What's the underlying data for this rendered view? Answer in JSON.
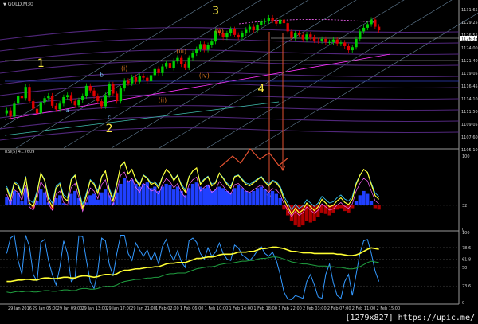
{
  "title": "GOLD,M30",
  "indicator_label": "RSI(5) 41.7609",
  "footer": "[1279x827] https://upic.me/",
  "colors": {
    "background": "#000000",
    "bull": "#00d100",
    "bear": "#e00000",
    "rsi": "#ffff33",
    "osc": "#3399ff",
    "hist_pos": "#2040ff",
    "hist_neg": "#b00000",
    "wave": "#ffee44",
    "sub": "#d07020",
    "arrow": "#e05030",
    "channel": "#5a2b8a",
    "trend": "#ff33ff"
  },
  "chart_data": {
    "type": "candlestick",
    "price_axis": [
      "1131.65",
      "1129.25",
      "1126.55",
      "1124.00",
      "1121.40",
      "1119.05",
      "1116.45",
      "1114.10",
      "1111.50",
      "1109.05",
      "1107.60",
      "1105.10"
    ],
    "price_range": [
      1104.8,
      1132.6
    ],
    "last_price": "1126.35",
    "close_series": [
      1112.2,
      1111.0,
      1113.5,
      1115.0,
      1114.6,
      1116.8,
      1114.0,
      1112.5,
      1111.6,
      1113.8,
      1114.6,
      1115.1,
      1113.1,
      1112.4,
      1113.5,
      1114.8,
      1115.2,
      1114.0,
      1113.2,
      1114.2,
      1115.0,
      1117.0,
      1116.1,
      1115.0,
      1114.0,
      1113.0,
      1115.2,
      1117.3,
      1115.5,
      1114.0,
      1116.5,
      1118.0,
      1117.5,
      1118.7,
      1117.8,
      1118.9,
      1118.6,
      1117.9,
      1119.1,
      1120.3,
      1119.5,
      1120.8,
      1121.5,
      1120.5,
      1121.9,
      1122.5,
      1121.2,
      1120.6,
      1122.5,
      1123.4,
      1124.2,
      1125.2,
      1124.1,
      1125.0,
      1125.7,
      1127.8,
      1127.4,
      1126.5,
      1127.3,
      1128.1,
      1127.0,
      1126.5,
      1127.3,
      1128.0,
      1128.6,
      1127.9,
      1128.9,
      1129.6,
      1129.7,
      1130.4,
      1129.8,
      1129.2,
      1130.0,
      1129.3,
      1127.7,
      1126.4,
      1127.3,
      1127.0,
      1126.1,
      1127.1,
      1126.5,
      1125.9,
      1125.8,
      1126.2,
      1125.6,
      1125.6,
      1126.1,
      1125.3,
      1125.5,
      1124.8,
      1124.0,
      1124.6,
      1126.2,
      1127.7,
      1128.4,
      1129.1,
      1130.0,
      1128.6,
      1127.9
    ],
    "wave_labels": [
      {
        "text": "1",
        "price": 1120.7,
        "bar": 9,
        "style": "major"
      },
      {
        "text": "2",
        "price": 1107.9,
        "bar": 27,
        "style": "major"
      },
      {
        "text": "3",
        "price": 1131.0,
        "bar": 55,
        "style": "major"
      },
      {
        "text": "4",
        "price": 1115.7,
        "bar": 67,
        "style": "major"
      },
      {
        "text": "a",
        "price": 1111.8,
        "bar": 16,
        "style": "minor"
      },
      {
        "text": "b",
        "price": 1118.8,
        "bar": 25,
        "style": "minor"
      },
      {
        "text": "c",
        "price": 1110.5,
        "bar": 27,
        "style": "minor"
      },
      {
        "text": "(i)",
        "price": 1120.0,
        "bar": 31,
        "style": "sub"
      },
      {
        "text": "(ii)",
        "price": 1113.8,
        "bar": 41,
        "style": "sub"
      },
      {
        "text": "(iii)",
        "price": 1123.4,
        "bar": 46,
        "style": "sub"
      },
      {
        "text": "(iv)",
        "price": 1118.6,
        "bar": 52,
        "style": "sub"
      },
      {
        "text": "(v)",
        "price": 1127.4,
        "bar": 56,
        "style": "sub"
      }
    ],
    "time_labels": [
      "29 Jan 2016",
      "29 Jan 05:00",
      "29 Jan 09:00",
      "29 Jan 13:00",
      "29 Jan 17:00",
      "29 Jan 21:00",
      "1 Feb 02:00",
      "1 Feb 06:00",
      "1 Feb 10:00",
      "1 Feb 14:00",
      "1 Feb 18:00",
      "1 Feb 22:00",
      "2 Feb 03:00",
      "2 Feb 07:00",
      "2 Feb 11:00",
      "2 Feb 15:00"
    ],
    "rsi": {
      "axis": [
        "100",
        "32",
        "0"
      ],
      "values": [
        55,
        40,
        62,
        58,
        45,
        70,
        35,
        30,
        48,
        75,
        65,
        40,
        30,
        55,
        60,
        42,
        38,
        66,
        72,
        50,
        28,
        45,
        65,
        60,
        48,
        70,
        78,
        52,
        38,
        60,
        85,
        90,
        74,
        80,
        66,
        58,
        72,
        68,
        60,
        62,
        55,
        70,
        80,
        75,
        65,
        72,
        58,
        50,
        70,
        78,
        82,
        60,
        66,
        70,
        58,
        62,
        75,
        68,
        60,
        55,
        70,
        72,
        66,
        60,
        58,
        62,
        66,
        70,
        63,
        58,
        64,
        62,
        55,
        40,
        30,
        20,
        28,
        22,
        26,
        35,
        30,
        25,
        30,
        40,
        35,
        30,
        32,
        38,
        42,
        36,
        33,
        40,
        60,
        72,
        80,
        76,
        60,
        45,
        40
      ],
      "histogram": [
        12,
        8,
        20,
        18,
        6,
        24,
        2,
        -4,
        6,
        22,
        18,
        4,
        -6,
        10,
        14,
        3,
        0,
        16,
        20,
        10,
        -4,
        4,
        14,
        16,
        8,
        18,
        22,
        14,
        4,
        18,
        30,
        38,
        34,
        36,
        30,
        26,
        30,
        32,
        24,
        26,
        20,
        26,
        30,
        28,
        22,
        26,
        20,
        14,
        24,
        30,
        32,
        26,
        24,
        28,
        20,
        22,
        26,
        24,
        20,
        18,
        24,
        28,
        24,
        20,
        18,
        20,
        24,
        26,
        22,
        18,
        20,
        16,
        10,
        -6,
        -14,
        -22,
        -28,
        -30,
        -28,
        -22,
        -24,
        -22,
        -16,
        -10,
        -12,
        -14,
        -10,
        -6,
        -4,
        -8,
        -10,
        -4,
        6,
        14,
        20,
        16,
        6,
        -4,
        -6
      ]
    },
    "oscillator": {
      "axis": [
        "100",
        "78.6",
        "61.8",
        "50",
        "23.6",
        "0"
      ],
      "blue": [
        70,
        92,
        96,
        60,
        40,
        96,
        80,
        40,
        30,
        86,
        90,
        60,
        40,
        25,
        50,
        88,
        70,
        30,
        35,
        95,
        94,
        60,
        30,
        20,
        45,
        92,
        88,
        55,
        38,
        70,
        96,
        96,
        70,
        60,
        85,
        75,
        66,
        75,
        60,
        72,
        55,
        80,
        90,
        70,
        60,
        74,
        58,
        50,
        88,
        92,
        86,
        70,
        62,
        78,
        66,
        72,
        85,
        70,
        62,
        60,
        82,
        78,
        68,
        64,
        60,
        66,
        74,
        80,
        70,
        66,
        72,
        60,
        40,
        15,
        5,
        4,
        10,
        8,
        6,
        30,
        40,
        25,
        8,
        6,
        40,
        55,
        28,
        10,
        6,
        30,
        40,
        10,
        40,
        70,
        88,
        90,
        70,
        45,
        30
      ],
      "yellow": [
        30,
        30,
        31,
        32,
        32,
        33,
        33,
        32,
        32,
        34,
        35,
        35,
        34,
        34,
        35,
        36,
        36,
        35,
        35,
        37,
        38,
        38,
        37,
        36,
        37,
        39,
        40,
        40,
        39,
        41,
        44,
        46,
        46,
        47,
        48,
        48,
        49,
        50,
        50,
        51,
        51,
        53,
        55,
        56,
        56,
        57,
        57,
        57,
        59,
        61,
        63,
        63,
        64,
        65,
        65,
        66,
        68,
        69,
        69,
        69,
        70,
        72,
        72,
        72,
        73,
        73,
        75,
        77,
        77,
        78,
        79,
        79,
        78,
        77,
        75,
        73,
        73,
        72,
        71,
        71,
        71,
        70,
        70,
        70,
        70,
        70,
        70,
        69,
        69,
        68,
        67,
        67,
        68,
        70,
        73,
        76,
        78,
        77,
        76
      ],
      "green": [
        15,
        14,
        15,
        16,
        15,
        16,
        16,
        15,
        15,
        16,
        17,
        17,
        16,
        16,
        17,
        18,
        18,
        17,
        17,
        19,
        20,
        20,
        19,
        19,
        20,
        22,
        23,
        23,
        23,
        25,
        28,
        30,
        31,
        32,
        33,
        33,
        34,
        35,
        35,
        36,
        36,
        38,
        40,
        41,
        41,
        42,
        42,
        42,
        44,
        46,
        48,
        49,
        50,
        51,
        51,
        52,
        54,
        55,
        56,
        56,
        57,
        58,
        59,
        59,
        60,
        60,
        62,
        63,
        63,
        64,
        65,
        65,
        64,
        62,
        60,
        58,
        57,
        56,
        55,
        55,
        54,
        53,
        52,
        52,
        52,
        51,
        51,
        50,
        50,
        49,
        48,
        48,
        49,
        51,
        54,
        57,
        59,
        58,
        57
      ]
    }
  }
}
